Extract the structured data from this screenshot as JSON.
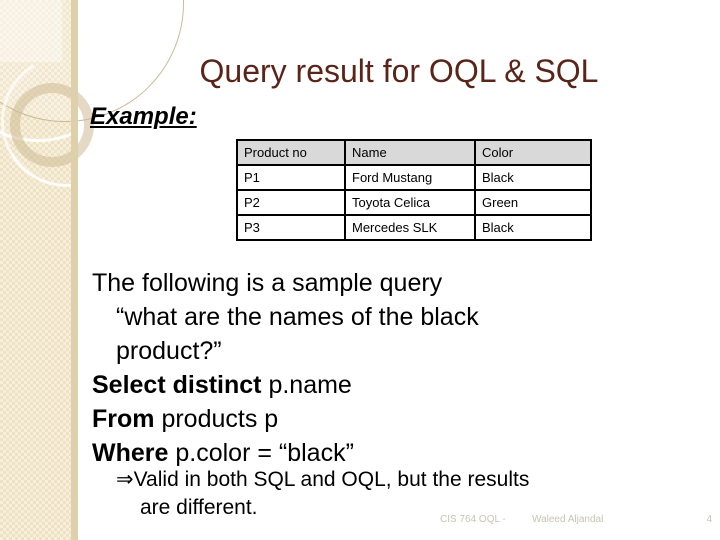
{
  "slide": {
    "title": "Query result for OQL & SQL",
    "title_color": "#5a2418",
    "example_label": "Example:"
  },
  "table": {
    "headers": [
      "Product no",
      "Name",
      "Color"
    ],
    "rows": [
      [
        "P1",
        "Ford Mustang",
        "Black"
      ],
      [
        "P2",
        "Toyota Celica",
        "Green"
      ],
      [
        "P3",
        "Mercedes SLK",
        "Black"
      ]
    ],
    "header_fill": "#d9d9d9",
    "border_color": "#000000"
  },
  "body": {
    "line1": "The following is a sample query",
    "line2": "“what are the names of the black",
    "line3": "product?”",
    "query": {
      "select_keyword": "Select distinct",
      "select_rest": " p.name",
      "from_keyword": "From",
      "from_rest": " products p",
      "where_keyword": "Where",
      "where_rest": " p.color = “black”"
    }
  },
  "sub_bullet": {
    "arrow": "⇒",
    "line1": "Valid in both SQL and OQL, but the results",
    "line2": "are different."
  },
  "footer": {
    "course": "CIS 764 OQL -",
    "author": "Waleed Aljandal",
    "page": "4",
    "color": "#c8c4b4"
  }
}
